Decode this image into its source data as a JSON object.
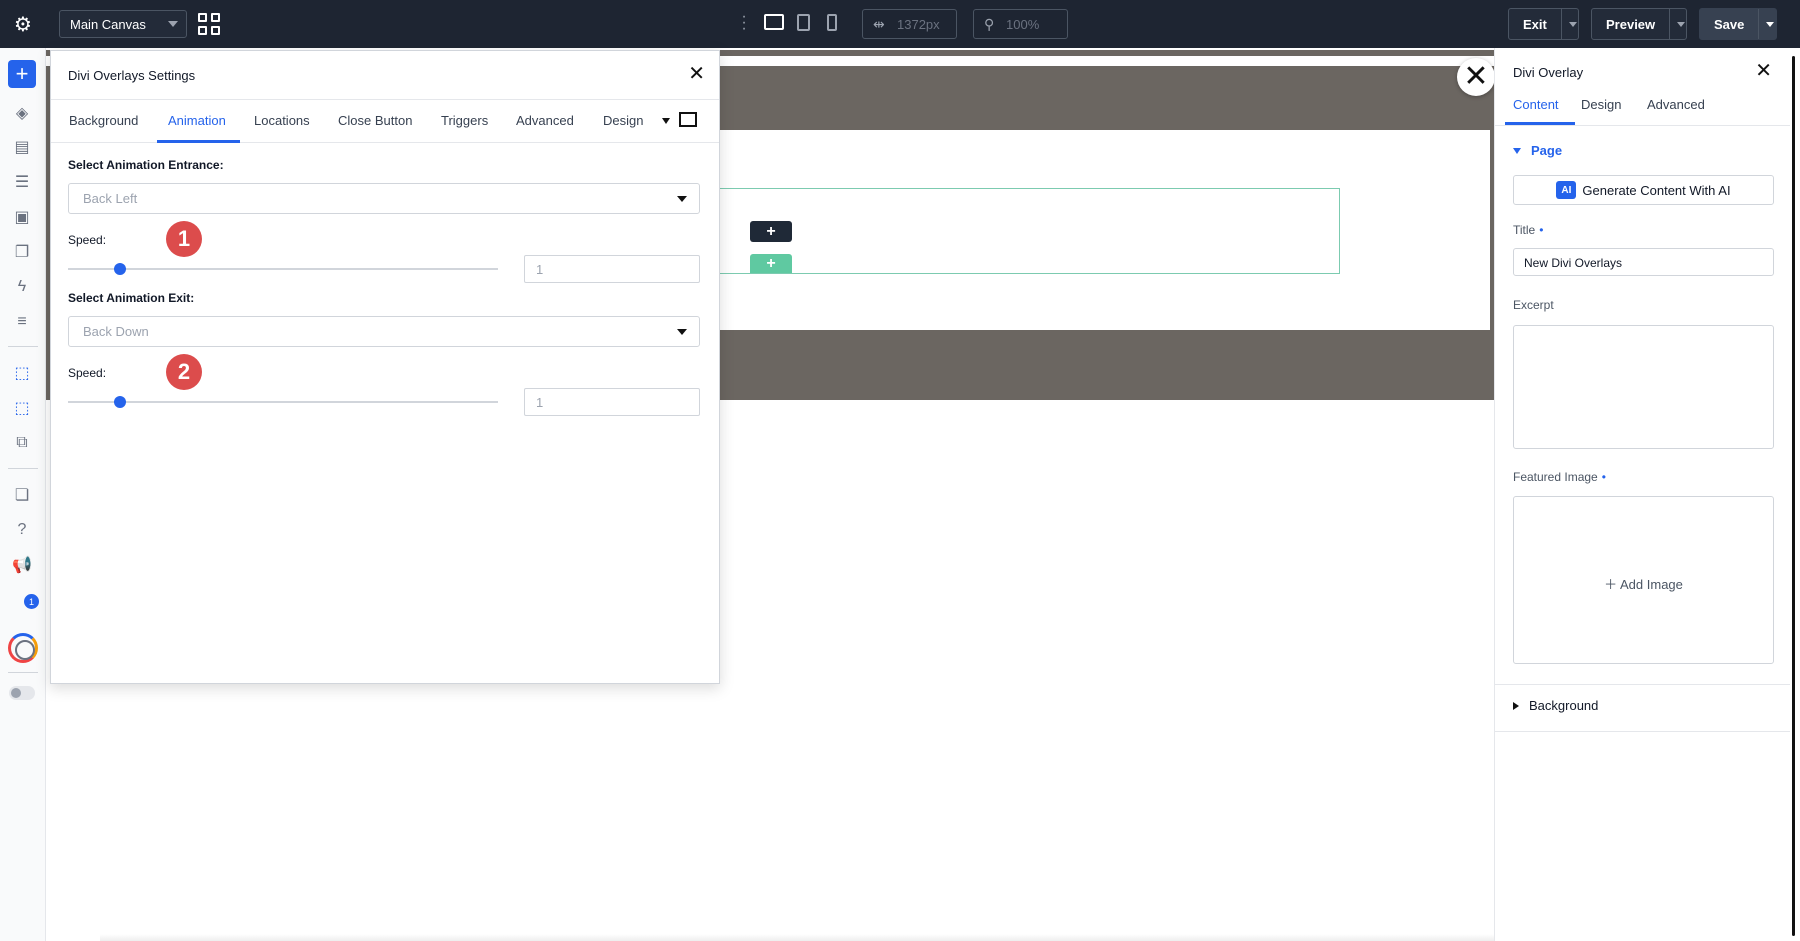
{
  "topbar": {
    "canvas_select": "Main Canvas",
    "width_value": "1372px",
    "zoom_value": "100%",
    "exit_label": "Exit",
    "preview_label": "Preview",
    "save_label": "Save"
  },
  "leftbar": {
    "notification_count": "1"
  },
  "modal": {
    "title": "Divi Overlays Settings",
    "tabs": [
      "Background",
      "Animation",
      "Locations",
      "Close Button",
      "Triggers",
      "Advanced",
      "Design"
    ],
    "active_tab": "Animation",
    "entrance": {
      "label": "Select Animation Entrance:",
      "value": "Back Left",
      "speed_label": "Speed:",
      "speed_value": "1",
      "marker": "1"
    },
    "exit": {
      "label": "Select Animation Exit:",
      "value": "Back Down",
      "speed_label": "Speed:",
      "speed_value": "1",
      "marker": "2"
    }
  },
  "right_panel": {
    "title": "Divi Overlay",
    "tabs": [
      "Content",
      "Design",
      "Advanced"
    ],
    "active_tab": "Content",
    "section_page": "Page",
    "ai_badge": "AI",
    "ai_button": "Generate Content With AI",
    "title_label": "Title",
    "title_value": "New Divi Overlays",
    "excerpt_label": "Excerpt",
    "featured_label": "Featured Image",
    "add_image": "Add Image",
    "section_background": "Background"
  },
  "colors": {
    "accent": "#2563eb",
    "topbar": "#1e2532",
    "marker": "#dc4c4c",
    "canvas_band": "#6b6661",
    "add_row_green": "#5fc9a1"
  }
}
